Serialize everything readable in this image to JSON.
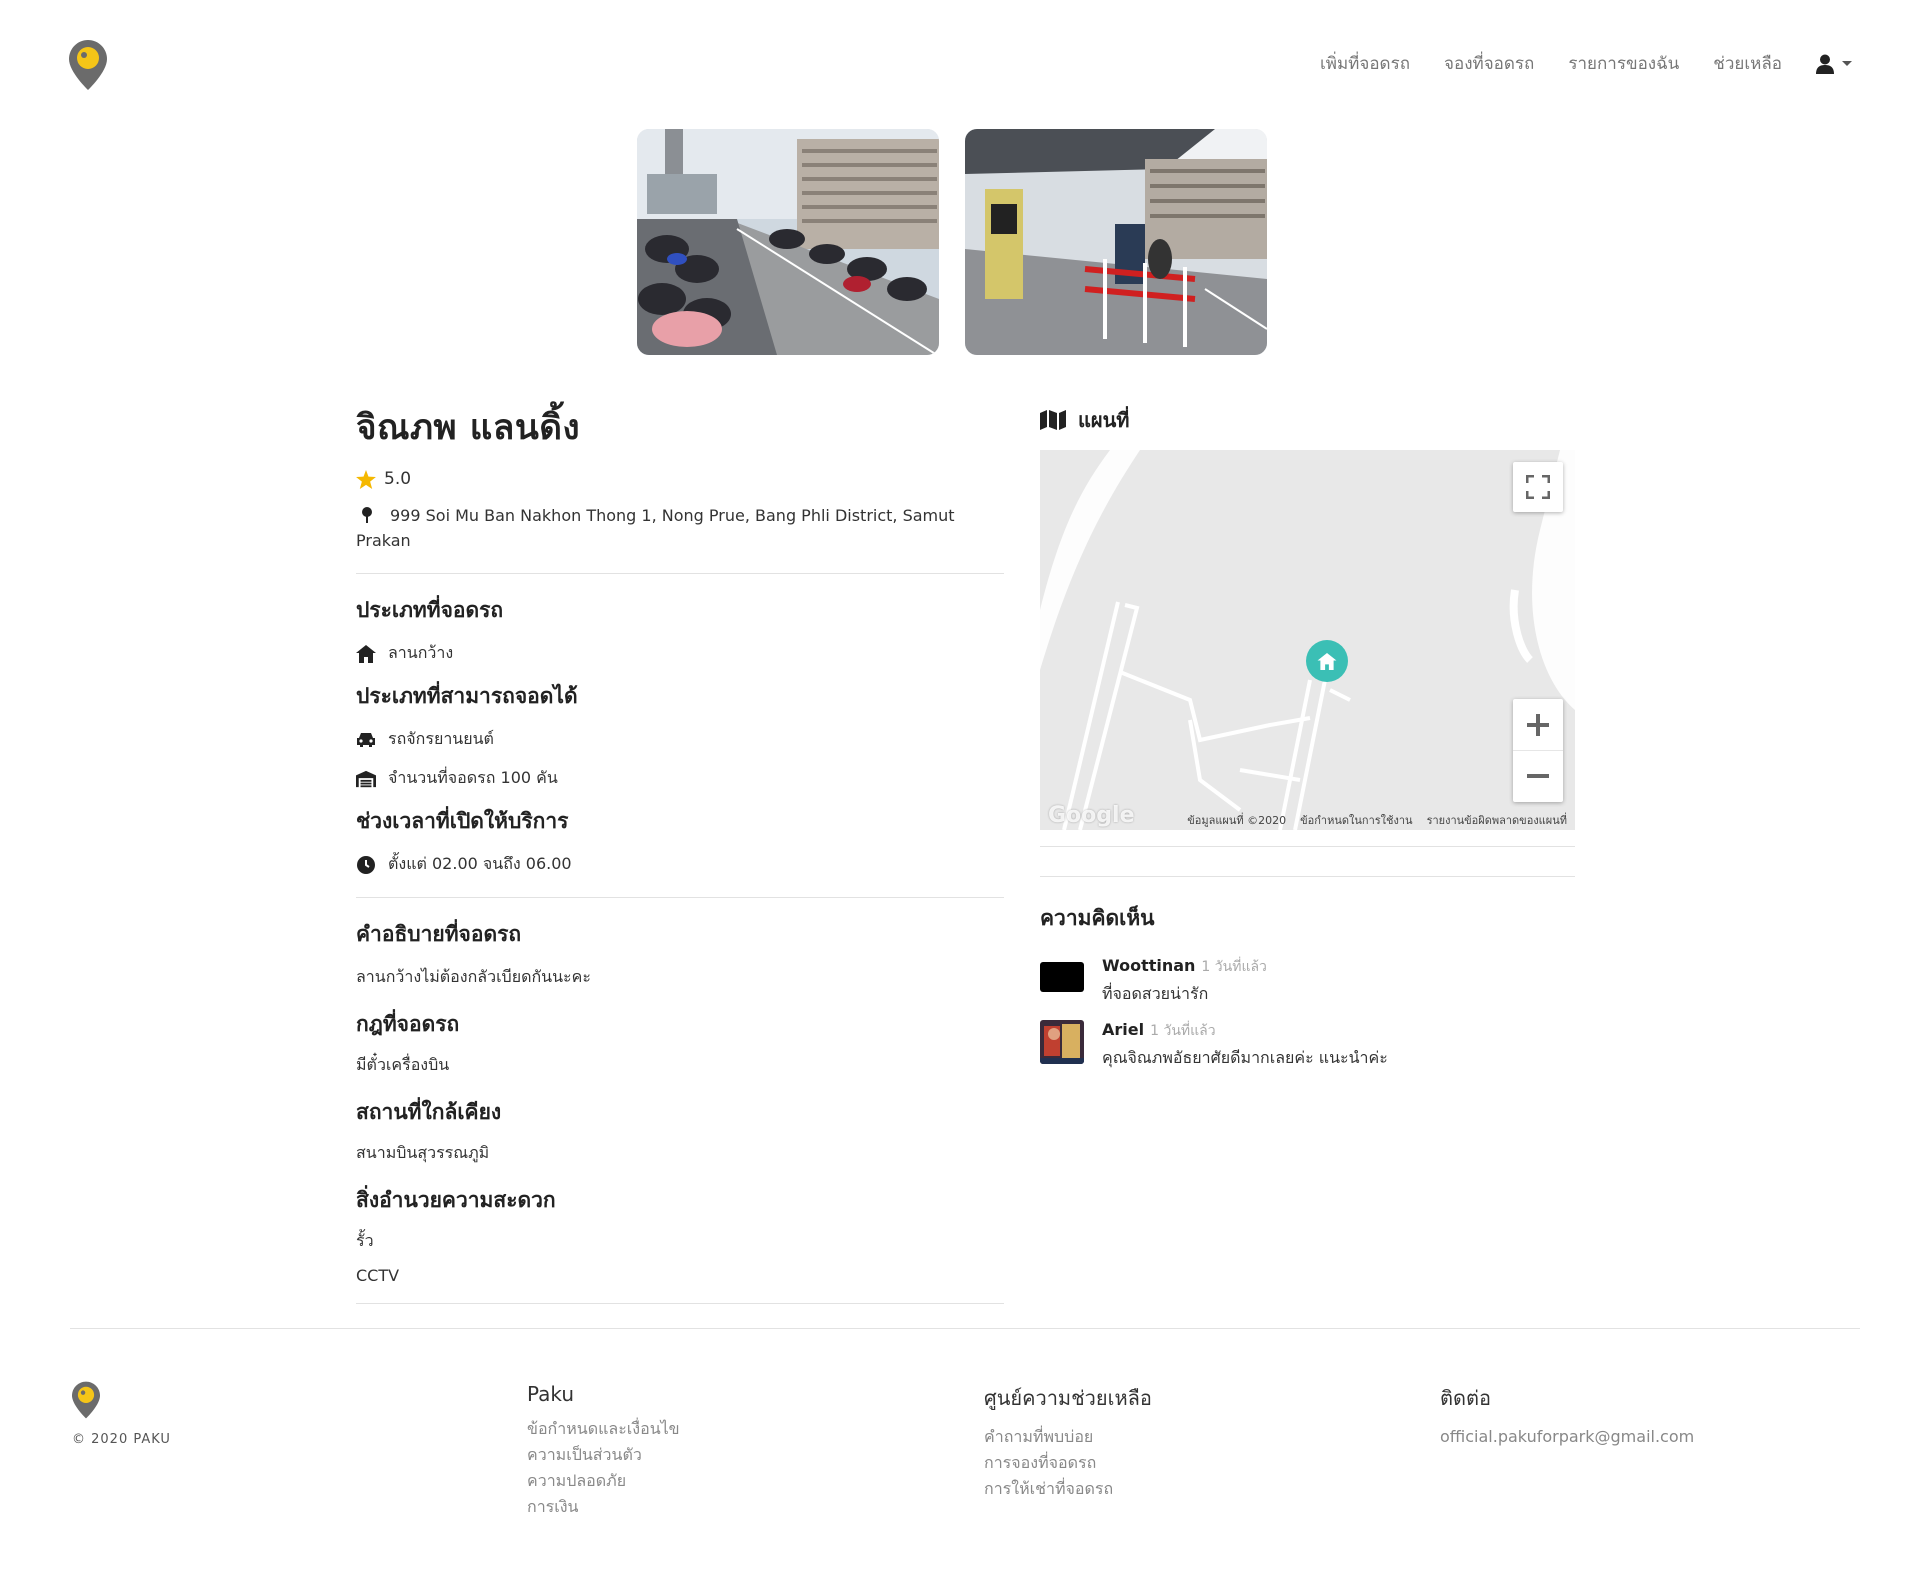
{
  "nav": {
    "items": [
      "เพิ่มที่จอดรถ",
      "จองที่จอดรถ",
      "รายการของฉัน",
      "ช่วยเหลือ"
    ]
  },
  "place": {
    "title": "จิณภพ แลนดิ้ง",
    "rating": "5.0",
    "address": "999 Soi Mu Ban Nakhon Thong 1, Nong Prue, Bang Phli District, Samut Prakan"
  },
  "details": {
    "type_heading": "ประเภทที่จอดรถ",
    "type_value": "ลานกว้าง",
    "vehicle_heading": "ประเภทที่สามารถจอดได้",
    "vehicle_value": "รถจักรยานยนต์",
    "capacity_value": "จำนวนที่จอดรถ 100 คัน",
    "hours_heading": "ช่วงเวลาที่เปิดให้บริการ",
    "hours_value": "ตั้งแต่ 02.00 จนถึง 06.00",
    "desc_heading": "คำอธิบายที่จอดรถ",
    "desc_value": "ลานกว้างไม่ต้องกลัวเบียดกันนะคะ",
    "rules_heading": "กฎที่จอดรถ",
    "rules_value": "มีตั๋วเครื่องบิน",
    "nearby_heading": "สถานที่ใกล้เคียง",
    "nearby_value": "สนามบินสุวรรณภูมิ",
    "amenities_heading": "สิ่งอำนวยความสะดวก",
    "amenities": [
      "รั้ว",
      "CCTV"
    ]
  },
  "map": {
    "title": "แผนที่",
    "google": "Google",
    "footer": [
      "ข้อมูลแผนที่ ©2020",
      "ข้อกำหนดในการใช้งาน",
      "รายงานข้อผิดพลาดของแผนที่"
    ]
  },
  "comments": {
    "title": "ความคิดเห็น",
    "items": [
      {
        "name": "Woottinan",
        "time": "1 วันที่แล้ว",
        "text": "ที่จอดสวยน่ารัก"
      },
      {
        "name": "Ariel",
        "time": "1 วันที่แล้ว",
        "text": "คุณจิณภพอัธยาศัยดีมากเลยค่ะ แนะนำค่ะ"
      }
    ]
  },
  "footer": {
    "copyright": "© 2020 PAKU",
    "col1": {
      "heading": "Paku",
      "links": [
        "ข้อกำหนดและเงื่อนไข",
        "ความเป็นส่วนตัว",
        "ความปลอดภัย",
        "การเงิน"
      ]
    },
    "col2": {
      "heading": "ศูนย์ความช่วยเหลือ",
      "links": [
        "คำถามที่พบบ่อย",
        "การจองที่จอดรถ",
        "การให้เช่าที่จอดรถ"
      ]
    },
    "col3": {
      "heading": "ติดต่อ",
      "links": [
        "official.pakuforpark@gmail.com"
      ]
    }
  },
  "colors": {
    "brand_pin": "#6b6b6b",
    "brand_yellow": "#f5c518",
    "marker": "#3bbfb5",
    "star": "#f5b800"
  }
}
